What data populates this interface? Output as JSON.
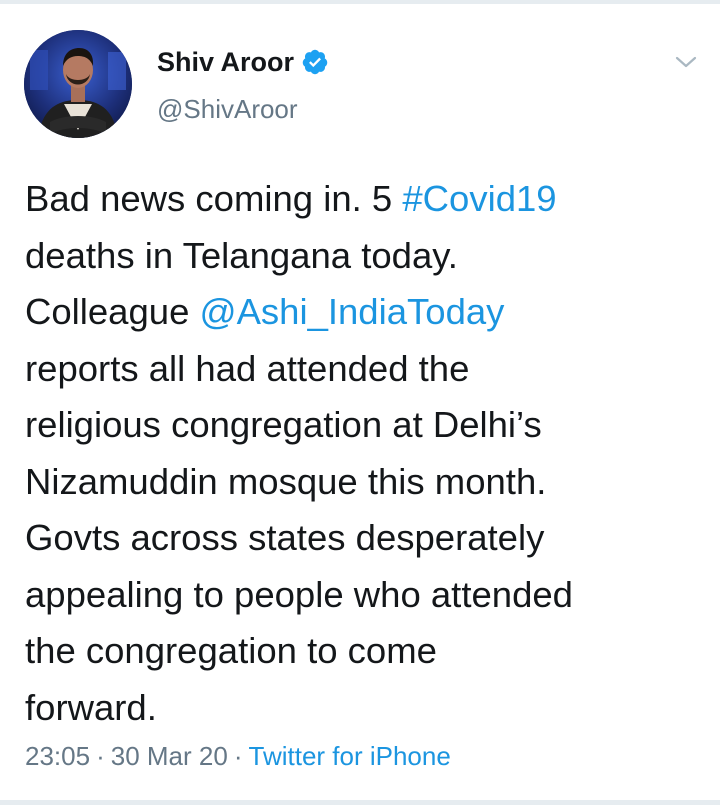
{
  "tweet": {
    "author": {
      "display_name": "Shiv Aroor",
      "handle": "@ShivAroor",
      "verified": true,
      "avatar_icon": "profile-photo"
    },
    "text_segments": [
      {
        "type": "text",
        "value": "Bad news coming in. 5 "
      },
      {
        "type": "hashtag",
        "value": "#Covid19"
      },
      {
        "type": "text",
        "value": " deaths in Telangana today. Colleague "
      },
      {
        "type": "mention",
        "value": "@Ashi_IndiaToday"
      },
      {
        "type": "text",
        "value": " reports all had attended the religious congregation at Delhi’s Nizamuddin mosque this month. Govts across states desperately appealing to people who attended the congregation to come forward."
      }
    ],
    "lines": {
      "l1a": "Bad news coming in. 5 ",
      "l1b": "#Covid19",
      "l2": "deaths in Telangana today.",
      "l3a": "Colleague ",
      "l3b": "@Ashi_IndiaToday",
      "l4": "reports all had attended the",
      "l5": "religious congregation at Delhi’s",
      "l6": "Nizamuddin mosque this month.",
      "l7": "Govts across states desperately",
      "l8": "appealing to people who attended",
      "l9": "the congregation to come",
      "l10": "forward."
    },
    "meta": {
      "time": "23:05",
      "separator": "·",
      "date": "30 Mar 20",
      "source": "Twitter for iPhone"
    },
    "menu_icon": "chevron-down-icon"
  },
  "colors": {
    "text": "#14171a",
    "secondary": "#657786",
    "link": "#1b95e0",
    "verified": "#1da1f2",
    "divider": "#e6ecf0"
  }
}
